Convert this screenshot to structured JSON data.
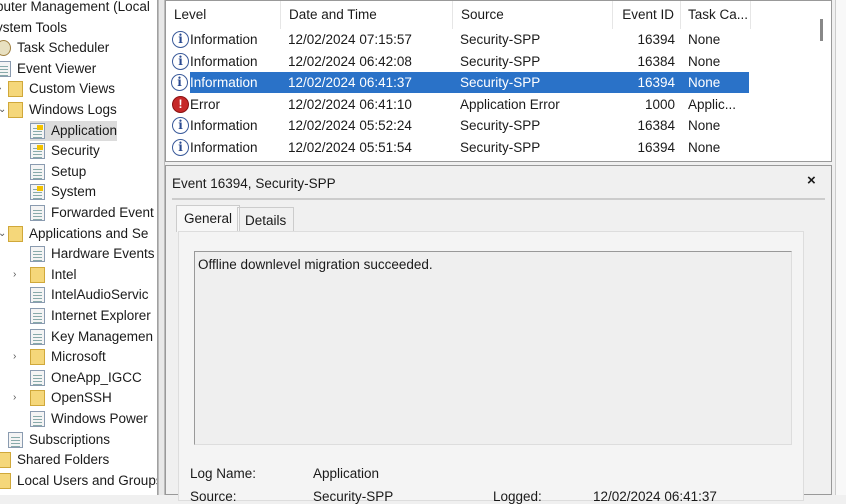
{
  "tree": [
    {
      "label": "puter Management (Local",
      "icon": "none",
      "indent": 0
    },
    {
      "label": "ystem Tools",
      "icon": "none",
      "indent": 0
    },
    {
      "label": "Task Scheduler",
      "icon": "clock",
      "indent": 0
    },
    {
      "label": "Event Viewer",
      "icon": "log",
      "indent": 0
    },
    {
      "label": "Custom Views",
      "icon": "folder",
      "indent": 1,
      "arrow": "›"
    },
    {
      "label": "Windows Logs",
      "icon": "folder",
      "indent": 1,
      "arrow": "⌄"
    },
    {
      "label": "Application",
      "icon": "logw",
      "indent": 2,
      "selected": true
    },
    {
      "label": "Security",
      "icon": "logw",
      "indent": 2
    },
    {
      "label": "Setup",
      "icon": "log",
      "indent": 2
    },
    {
      "label": "System",
      "icon": "logw",
      "indent": 2
    },
    {
      "label": "Forwarded Event",
      "icon": "log",
      "indent": 2
    },
    {
      "label": "Applications and Se",
      "icon": "folder",
      "indent": 1,
      "arrow": "⌄"
    },
    {
      "label": "Hardware Events",
      "icon": "log",
      "indent": 2
    },
    {
      "label": "Intel",
      "icon": "folder",
      "indent": 2,
      "arrow": "›"
    },
    {
      "label": "IntelAudioServic",
      "icon": "log",
      "indent": 2
    },
    {
      "label": "Internet Explorer",
      "icon": "log",
      "indent": 2
    },
    {
      "label": "Key Managemen",
      "icon": "log",
      "indent": 2
    },
    {
      "label": "Microsoft",
      "icon": "folder",
      "indent": 2,
      "arrow": "›"
    },
    {
      "label": "OneApp_IGCC",
      "icon": "log",
      "indent": 2
    },
    {
      "label": "OpenSSH",
      "icon": "folder",
      "indent": 2,
      "arrow": "›"
    },
    {
      "label": "Windows Power",
      "icon": "log",
      "indent": 2
    },
    {
      "label": "Subscriptions",
      "icon": "log",
      "indent": 1
    },
    {
      "label": "Shared Folders",
      "icon": "folder",
      "indent": 0
    },
    {
      "label": "Local Users and Groups",
      "icon": "folder",
      "indent": 0
    }
  ],
  "columns": [
    "Level",
    "Date and Time",
    "Source",
    "Event ID",
    "Task Ca..."
  ],
  "events": [
    {
      "level": "Information",
      "date": "12/02/2024 07:15:57",
      "source": "Security-SPP",
      "id": "16394",
      "task": "None"
    },
    {
      "level": "Information",
      "date": "12/02/2024 06:42:08",
      "source": "Security-SPP",
      "id": "16384",
      "task": "None"
    },
    {
      "level": "Information",
      "date": "12/02/2024 06:41:37",
      "source": "Security-SPP",
      "id": "16394",
      "task": "None",
      "selected": true
    },
    {
      "level": "Error",
      "date": "12/02/2024 06:41:10",
      "source": "Application Error",
      "id": "1000",
      "task": "Applic..."
    },
    {
      "level": "Information",
      "date": "12/02/2024 05:52:24",
      "source": "Security-SPP",
      "id": "16384",
      "task": "None"
    },
    {
      "level": "Information",
      "date": "12/02/2024 05:51:54",
      "source": "Security-SPP",
      "id": "16394",
      "task": "None"
    }
  ],
  "detail": {
    "title": "Event 16394, Security-SPP",
    "close": "×",
    "tabs": [
      "General",
      "Details"
    ],
    "message": "Offline downlevel migration succeeded.",
    "log_name_label": "Log Name:",
    "log_name": "Application",
    "source_label": "Source:",
    "source": "Security-SPP",
    "logged_label": "Logged:",
    "logged": "12/02/2024 06:41:37"
  }
}
